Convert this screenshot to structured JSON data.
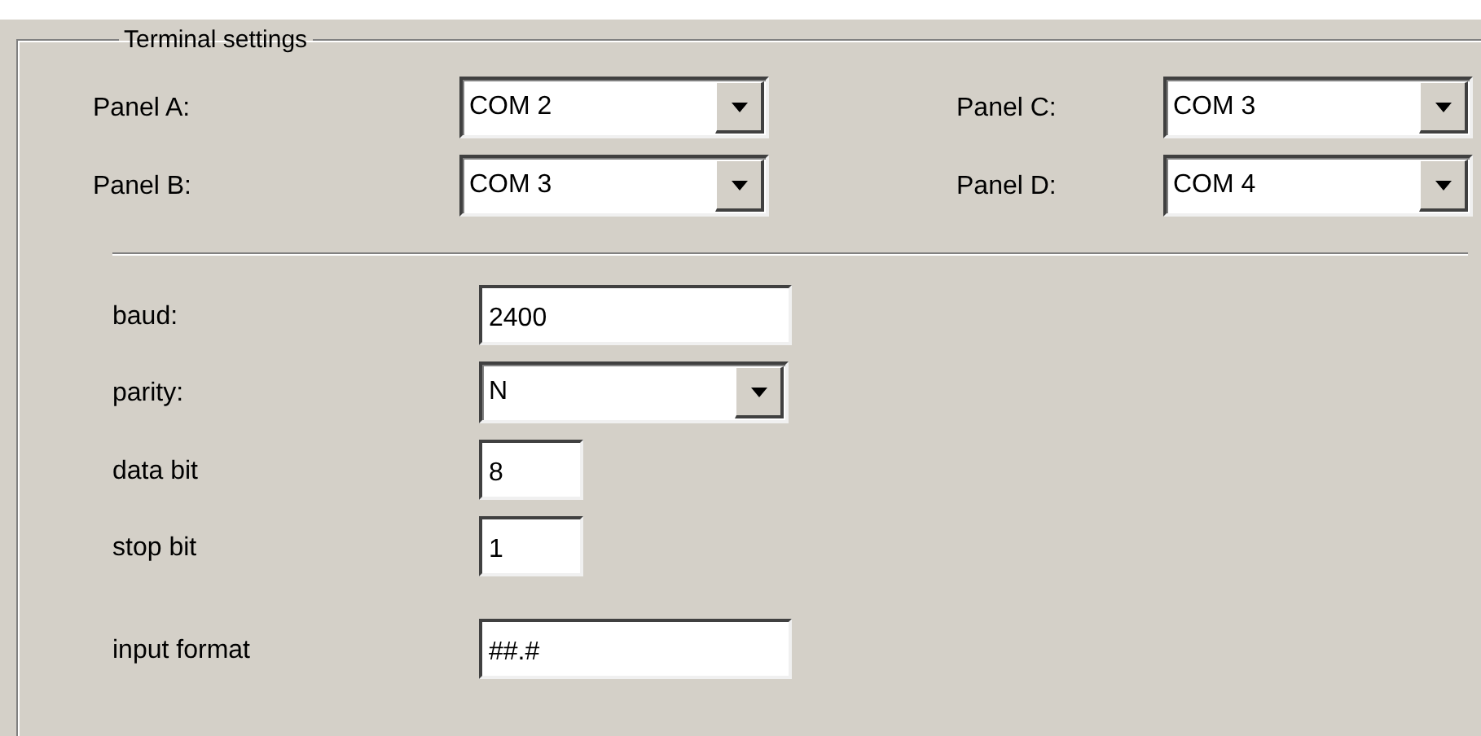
{
  "group": {
    "title": "Terminal settings"
  },
  "ports": [
    {
      "label": "Panel A:",
      "value": "COM 2"
    },
    {
      "label": "Panel C:",
      "value": "COM 3"
    },
    {
      "label": "Panel B:",
      "value": "COM 3"
    },
    {
      "label": "Panel D:",
      "value": "COM 4"
    }
  ],
  "fields": [
    {
      "label": "baud:",
      "value": "2400",
      "kind": "text"
    },
    {
      "label": "parity:",
      "value": "N",
      "kind": "combo"
    },
    {
      "label": "data bit",
      "value": "8",
      "kind": "small"
    },
    {
      "label": "stop bit",
      "value": "1",
      "kind": "small"
    },
    {
      "label": "input format",
      "value": "##.#",
      "kind": "text"
    }
  ]
}
